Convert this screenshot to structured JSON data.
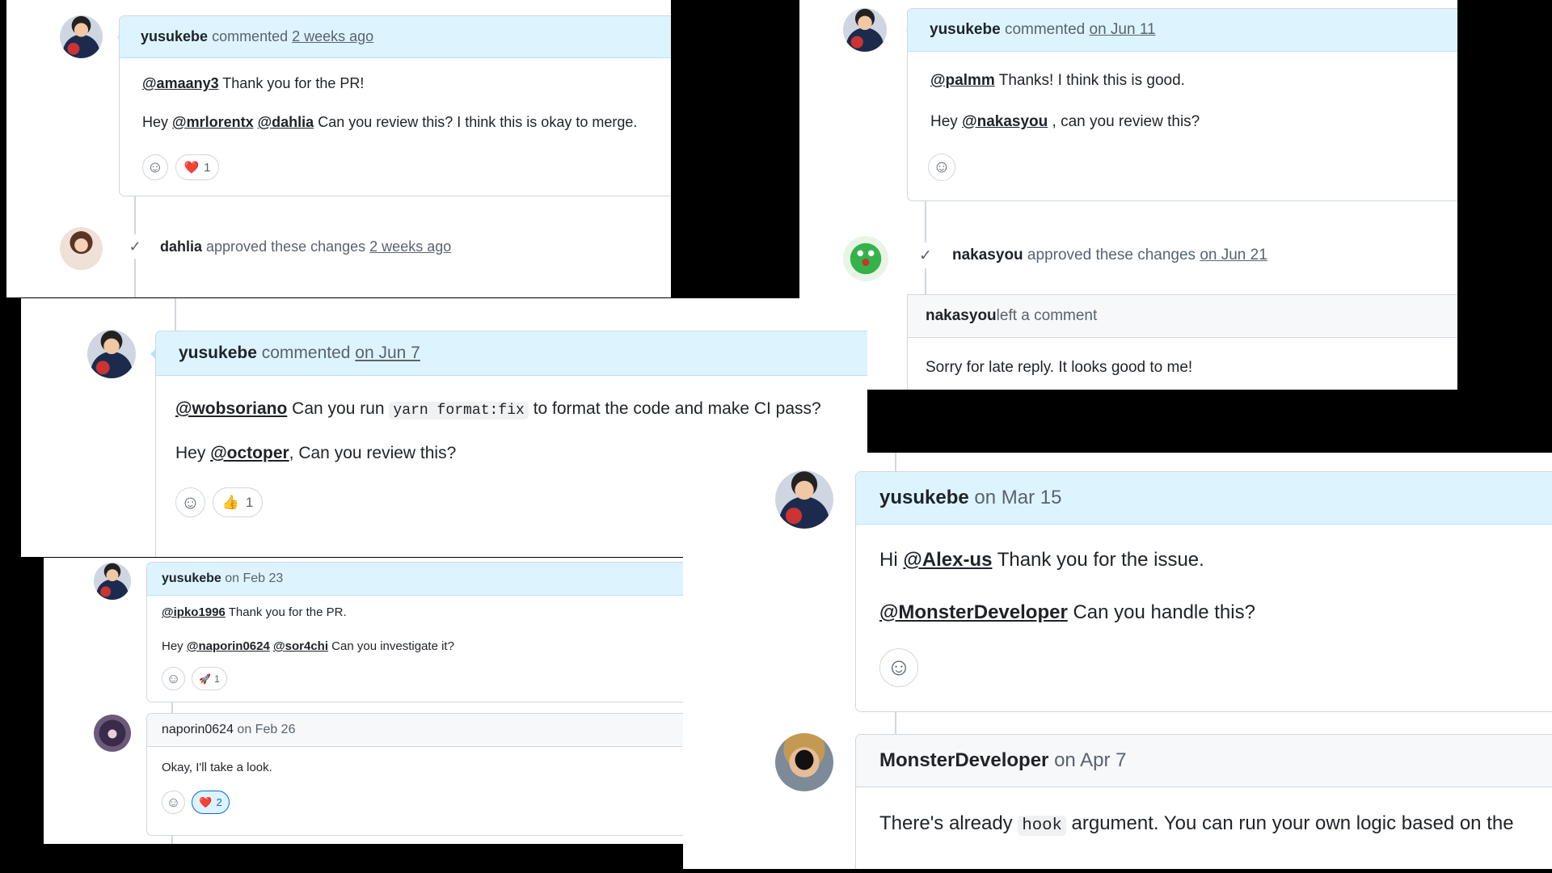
{
  "panel_a": {
    "comment": {
      "author": "yusukebe",
      "verb": "commented",
      "time": "2 weeks ago",
      "line1_mention": "@amaany3",
      "line1_text": " Thank you for the PR!",
      "line2_prefix": "Hey ",
      "line2_mention1": "@mrlorentx",
      "line2_mention2": "@dahlia",
      "line2_text": " Can you review this? I think this is okay to merge.",
      "reaction_emoji": "❤️",
      "reaction_count": "1"
    },
    "event": {
      "author": "dahlia",
      "text": " approved these changes ",
      "time": "2 weeks ago"
    }
  },
  "panel_b": {
    "comment": {
      "author": "yusukebe",
      "verb": "commented",
      "time": "on Jun 11",
      "line1_mention": "@palmm",
      "line1_text": " Thanks! I think this is good.",
      "line2_prefix": "Hey ",
      "line2_mention": "@nakasyou",
      "line2_text": " , can you review this?"
    },
    "event": {
      "author": "nakasyou",
      "text": " approved these changes ",
      "time": "on Jun 21"
    },
    "review": {
      "author": "nakasyou",
      "verb": " left a comment",
      "body": "Sorry for late reply. It looks good to me!"
    }
  },
  "panel_c": {
    "author": "yusukebe",
    "verb": "commented",
    "time": "on Jun 7",
    "line1_mention": "@wobsoriano",
    "line1_text_a": " Can you run ",
    "line1_code": "yarn format:fix",
    "line1_text_b": " to format the code and make CI pass?",
    "line2_prefix": "Hey ",
    "line2_mention": "@octoper",
    "line2_text": ", Can you review this?",
    "reaction_emoji": "👍",
    "reaction_count": "1"
  },
  "panel_d": {
    "comment1": {
      "author": "yusukebe",
      "time": "on Feb 23",
      "line1_mention": "@ipko1996",
      "line1_text": " Thank you for the PR.",
      "line2_prefix": "Hey ",
      "line2_mention1": "@naporin0624",
      "line2_mention2": "@sor4chi",
      "line2_text": " Can you investigate it?",
      "reaction_emoji": "🚀",
      "reaction_count": "1"
    },
    "comment2": {
      "author": "naporin0624",
      "time": "on Feb 26",
      "body": "Okay, I'll take a look.",
      "reaction_emoji": "❤️",
      "reaction_count": "2"
    }
  },
  "panel_e": {
    "comment1": {
      "author": "yusukebe",
      "time": "on Mar 15",
      "line1_prefix": "Hi ",
      "line1_mention": "@Alex-us",
      "line1_text": " Thank you for the issue.",
      "line2_mention": "@MonsterDeveloper",
      "line2_text": " Can you handle this?"
    },
    "comment2": {
      "author": "MonsterDeveloper",
      "time": "on Apr 7",
      "body_a": "There's already ",
      "body_code": "hook",
      "body_b": " argument. You can run your own logic based on the"
    }
  },
  "icons": {
    "smiley": "☺",
    "check": "✓"
  },
  "colors": {
    "header_blue": "#ddf4ff",
    "border": "#d0d7de",
    "text": "#1f2328",
    "muted": "#59636e"
  }
}
